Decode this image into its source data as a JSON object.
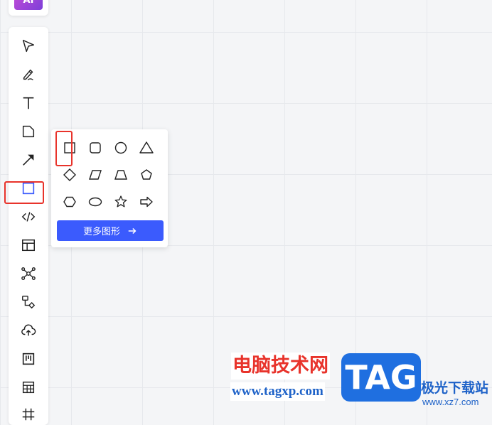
{
  "app": {
    "logo_text": "AI"
  },
  "toolbar": {
    "tools": [
      {
        "name": "select-tool",
        "icon": "cursor-icon"
      },
      {
        "name": "pen-tool",
        "icon": "pen-icon"
      },
      {
        "name": "text-tool",
        "icon": "text-icon"
      },
      {
        "name": "sticky-note-tool",
        "icon": "sticky-note-icon"
      },
      {
        "name": "arrow-tool",
        "icon": "arrow-icon"
      },
      {
        "name": "shape-tool",
        "icon": "square-icon",
        "active": true
      },
      {
        "name": "code-tool",
        "icon": "code-icon"
      },
      {
        "name": "layout-tool",
        "icon": "layout-icon"
      },
      {
        "name": "mindmap-tool",
        "icon": "mindmap-icon"
      },
      {
        "name": "flowchart-tool",
        "icon": "flowchart-icon"
      },
      {
        "name": "upload-tool",
        "icon": "upload-icon"
      },
      {
        "name": "kanban-tool",
        "icon": "kanban-icon"
      },
      {
        "name": "table-tool",
        "icon": "table-icon"
      },
      {
        "name": "frame-tool",
        "icon": "frame-icon"
      }
    ]
  },
  "shape_panel": {
    "shapes": [
      "rectangle",
      "rounded-rectangle",
      "circle",
      "triangle",
      "diamond",
      "parallelogram",
      "trapezoid",
      "pentagon",
      "hexagon",
      "ellipse",
      "star",
      "arrow-right"
    ],
    "more_label": "更多图形"
  },
  "watermark": {
    "title": "电脑技术网",
    "url": "www.tagxp.com",
    "tag": "TAG",
    "site_name": "极光下载站",
    "site_url": "www.xz7.com"
  },
  "colors": {
    "accent": "#3b5bfd",
    "highlight_red": "#e8332b",
    "watermark_blue": "#1f6fe0"
  }
}
